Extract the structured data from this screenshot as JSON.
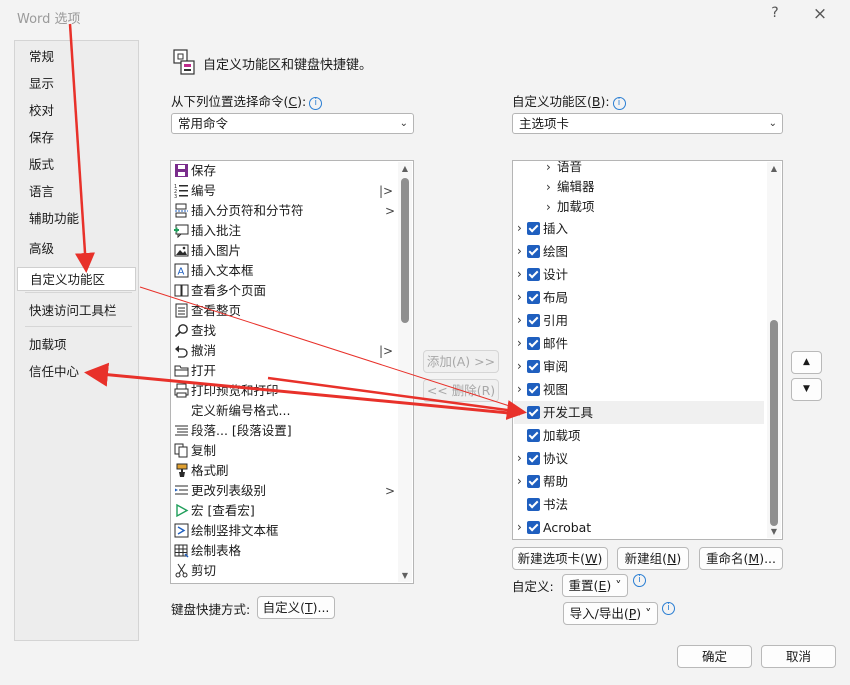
{
  "window": {
    "title": "Word 选项",
    "help_glyph": "?",
    "close_glyph": "×"
  },
  "nav": {
    "items": [
      "常规",
      "显示",
      "校对",
      "保存",
      "版式",
      "语言",
      "辅助功能",
      "高级",
      "自定义功能区",
      "快速访问工具栏",
      "加载项",
      "信任中心"
    ],
    "selected": "自定义功能区"
  },
  "header": {
    "text": "自定义功能区和键盘快捷键。"
  },
  "left": {
    "label_pre": "从下列位置选择命令(",
    "label_key": "C",
    "label_post": "):",
    "combo_value": "常用命令",
    "commands": [
      {
        "label": "保存",
        "icon": "save-icon",
        "sub": ""
      },
      {
        "label": "编号",
        "icon": "numbering-icon",
        "sub": "|>"
      },
      {
        "label": "插入分页符和分节符",
        "icon": "page-break-icon",
        "sub": ">"
      },
      {
        "label": "插入批注",
        "icon": "comment-icon",
        "sub": ""
      },
      {
        "label": "插入图片",
        "icon": "picture-icon",
        "sub": ""
      },
      {
        "label": "插入文本框",
        "icon": "textbox-icon",
        "sub": ""
      },
      {
        "label": "查看多个页面",
        "icon": "multi-page-icon",
        "sub": ""
      },
      {
        "label": "查看整页",
        "icon": "page-icon",
        "sub": ""
      },
      {
        "label": "查找",
        "icon": "search-icon",
        "sub": ""
      },
      {
        "label": "撤消",
        "icon": "undo-icon",
        "sub": "|>"
      },
      {
        "label": "打开",
        "icon": "folder-icon",
        "sub": ""
      },
      {
        "label": "打印预览和打印",
        "icon": "print-icon",
        "sub": ""
      },
      {
        "label": "定义新编号格式...",
        "icon": "",
        "sub": ""
      },
      {
        "label": "段落... [段落设置]",
        "icon": "paragraph-icon",
        "sub": ""
      },
      {
        "label": "复制",
        "icon": "copy-icon",
        "sub": ""
      },
      {
        "label": "格式刷",
        "icon": "format-painter-icon",
        "sub": ""
      },
      {
        "label": "更改列表级别",
        "icon": "list-level-icon",
        "sub": ">"
      },
      {
        "label": "宏 [查看宏]",
        "icon": "macro-icon",
        "sub": ""
      },
      {
        "label": "绘制竖排文本框",
        "icon": "vertical-textbox-icon",
        "sub": ""
      },
      {
        "label": "绘制表格",
        "icon": "table-icon",
        "sub": ""
      },
      {
        "label": "剪切",
        "icon": "scissors-icon",
        "sub": ""
      }
    ]
  },
  "middle": {
    "add": "添加(A) >>",
    "remove": "<< 删除(R)"
  },
  "right": {
    "label_pre": "自定义功能区(",
    "label_key": "B",
    "label_post": "):",
    "combo_value": "主选项卡",
    "children": [
      "语音",
      "编辑器",
      "加载项"
    ],
    "tabs": [
      {
        "label": "插入",
        "chevron": true
      },
      {
        "label": "绘图",
        "chevron": true
      },
      {
        "label": "设计",
        "chevron": true
      },
      {
        "label": "布局",
        "chevron": true
      },
      {
        "label": "引用",
        "chevron": true
      },
      {
        "label": "邮件",
        "chevron": true
      },
      {
        "label": "审阅",
        "chevron": true
      },
      {
        "label": "视图",
        "chevron": true
      },
      {
        "label": "开发工具",
        "chevron": true
      },
      {
        "label": "加载项",
        "chevron": false
      },
      {
        "label": "协议",
        "chevron": true
      },
      {
        "label": "帮助",
        "chevron": true
      },
      {
        "label": "书法",
        "chevron": false
      },
      {
        "label": "Acrobat",
        "chevron": true
      }
    ],
    "selected": "开发工具",
    "move_up": "▲",
    "move_down": "▼"
  },
  "buttons": {
    "new_tab_pre": "新建选项卡(",
    "new_tab_key": "W",
    "new_tab_post": ")",
    "new_group_pre": "新建组(",
    "new_group_key": "N",
    "new_group_post": ")",
    "rename_pre": "重命名(",
    "rename_key": "M",
    "rename_post": ")...",
    "customize_label": "自定义:",
    "reset_pre": "重置(",
    "reset_key": "E",
    "reset_post": ") ˅",
    "import_export_pre": "导入/导出(",
    "import_export_key": "P",
    "import_export_post": ") ˅",
    "shortcut_label": "键盘快捷方式:",
    "shortcut_btn_pre": "自定义(",
    "shortcut_btn_key": "T",
    "shortcut_btn_post": ")...",
    "ok": "确定",
    "cancel": "取消"
  },
  "annotation_color": "#e8312a"
}
